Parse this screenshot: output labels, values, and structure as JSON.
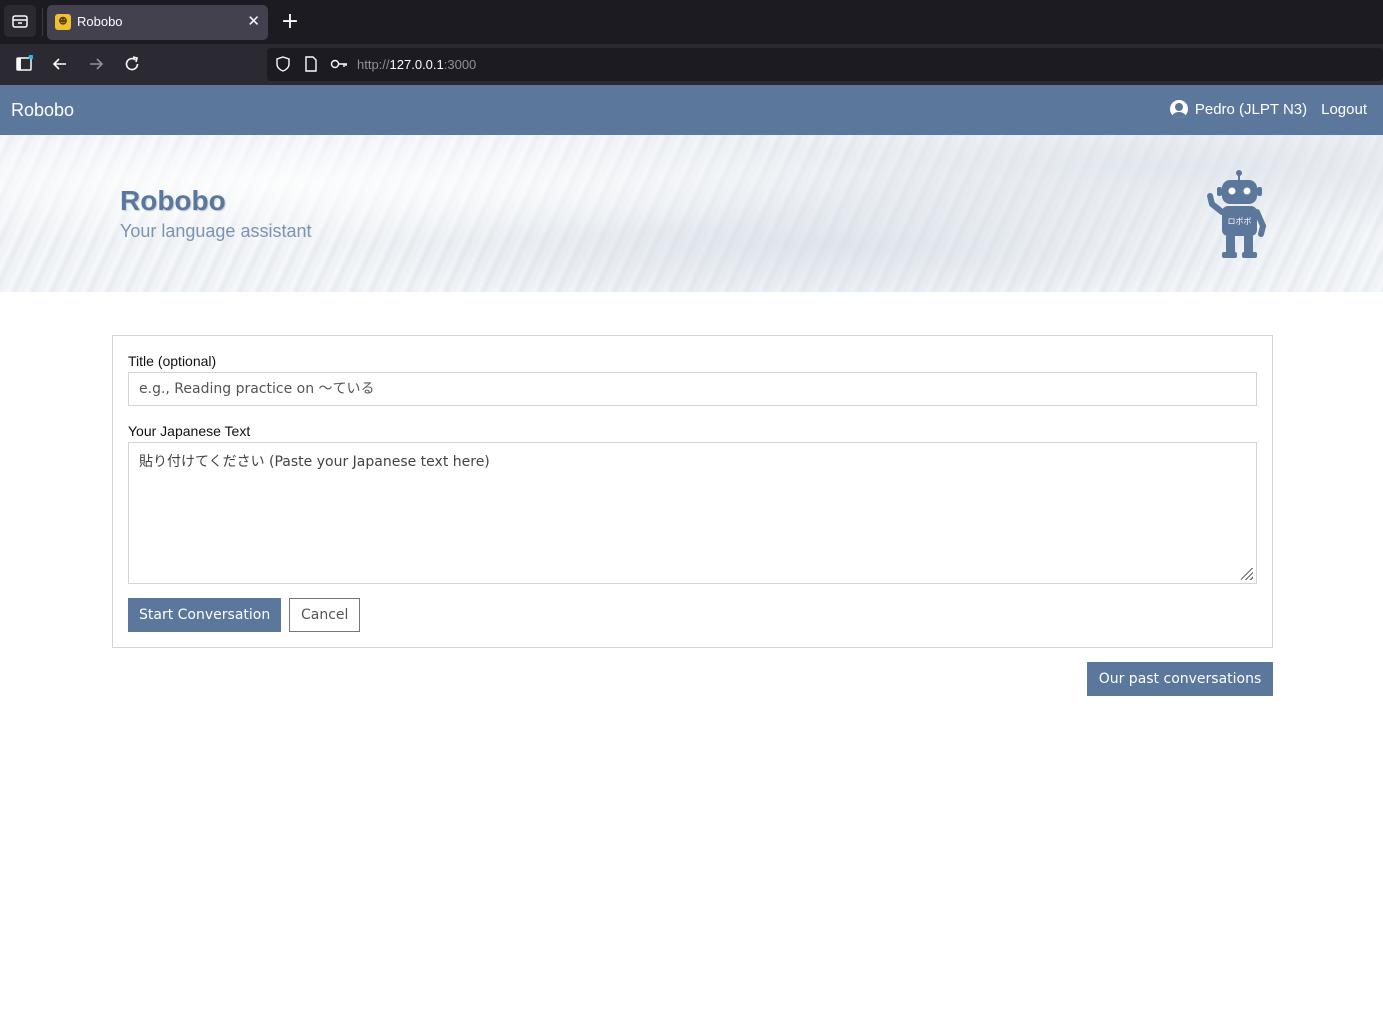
{
  "browser": {
    "tab_title": "Robobo",
    "new_tab_symbol": "+",
    "close_symbol": "✕",
    "url_scheme": "http://",
    "url_host": "127.0.0.1",
    "url_port": ":3000"
  },
  "navbar": {
    "brand": "Robobo",
    "user": "Pedro (JLPT N3)",
    "logout": "Logout"
  },
  "hero": {
    "title": "Robobo",
    "subtitle": "Your language assistant",
    "robot_label": "ロボボ"
  },
  "form": {
    "title_label": "Title (optional)",
    "title_placeholder": "e.g., Reading practice on ～ている",
    "text_label": "Your Japanese Text",
    "text_placeholder": "貼り付けてください (Paste your Japanese text here)",
    "start_button": "Start Conversation",
    "cancel_button": "Cancel"
  },
  "past_button": "Our past conversations",
  "colors": {
    "accent": "#5b779c",
    "browser_dark": "#1c1b22"
  }
}
